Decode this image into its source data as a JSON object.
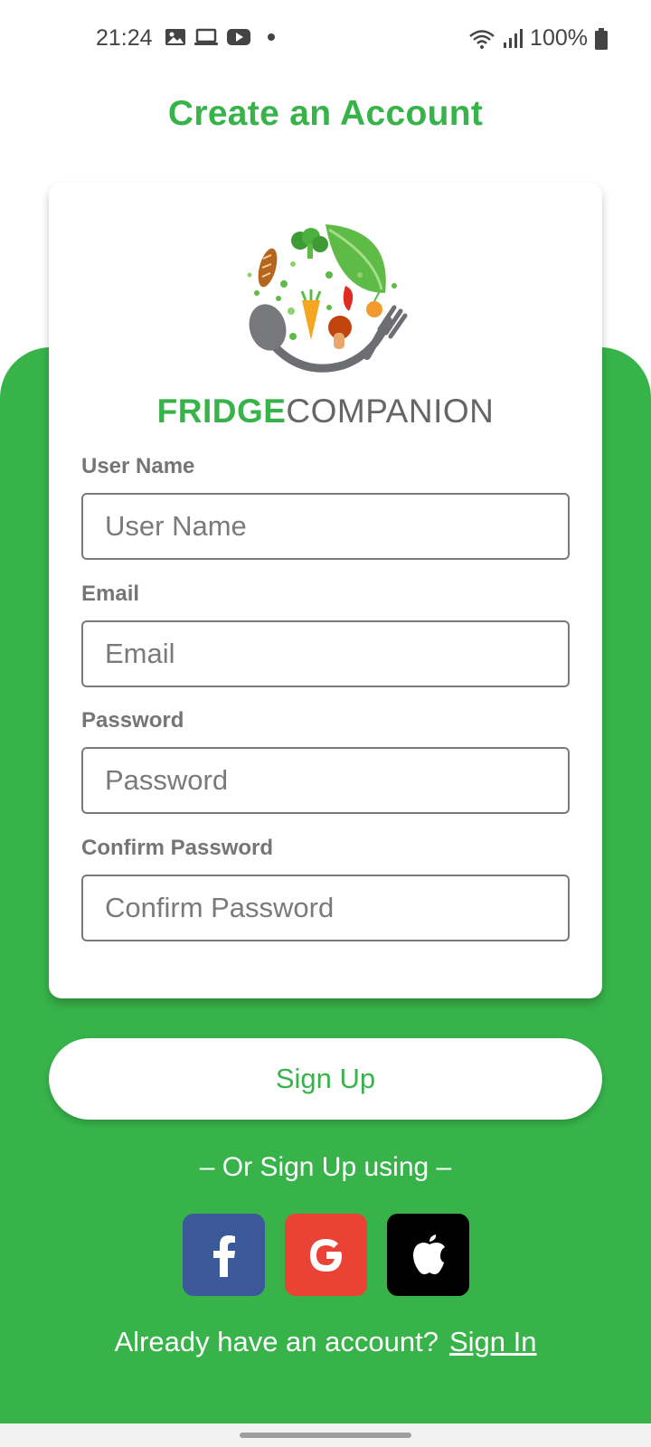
{
  "status_bar": {
    "time": "21:24",
    "left_icons": [
      "image-icon",
      "laptop-icon",
      "youtube-icon",
      "dot-icon"
    ],
    "right_icons": [
      "wifi-icon",
      "signal-icon",
      "battery-icon"
    ],
    "battery": "100%"
  },
  "page": {
    "title": "Create an Account"
  },
  "logo": {
    "brand_bold": "FRIDGE",
    "brand_light": "COMPANION",
    "icon": "food-plate-logo"
  },
  "form": {
    "username": {
      "label": "User Name",
      "placeholder": "User Name",
      "value": ""
    },
    "email": {
      "label": "Email",
      "placeholder": "Email",
      "value": ""
    },
    "password": {
      "label": "Password",
      "placeholder": "Password",
      "value": ""
    },
    "confirm_password": {
      "label": "Confirm Password",
      "placeholder": "Confirm Password",
      "value": ""
    }
  },
  "actions": {
    "signup_label": "Sign Up",
    "or_text": "– Or Sign Up using –",
    "social": [
      "facebook-icon",
      "google-icon",
      "apple-icon"
    ],
    "already_text": "Already have an account?",
    "signin_label": "Sign In"
  },
  "colors": {
    "accent": "#37b34a",
    "facebook": "#3b5998",
    "google": "#ea4335",
    "apple": "#000000"
  }
}
